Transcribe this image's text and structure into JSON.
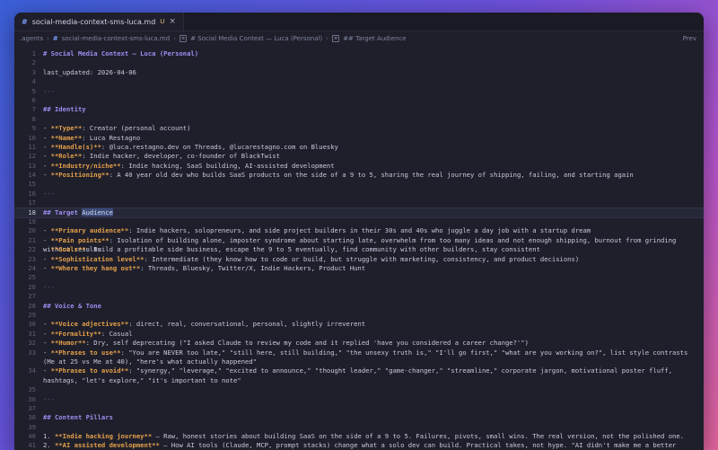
{
  "tab": {
    "icon": "#",
    "title": "social-media-context-sms-luca.md",
    "modified": "U"
  },
  "breadcrumb": {
    "folder": ".agents",
    "file": "social-media-context-sms-luca.md",
    "h1": "# Social Media Context — Luca (Personal)",
    "h2": "## Target Audience",
    "preview": "Prev"
  },
  "lines": [
    {
      "n": "1",
      "segs": [
        {
          "t": "# Social Media Context — Luca (Personal)",
          "c": "h"
        }
      ]
    },
    {
      "n": "2",
      "segs": []
    },
    {
      "n": "3",
      "segs": [
        {
          "t": "last_updated: 2026-04-06"
        }
      ]
    },
    {
      "n": "4",
      "segs": []
    },
    {
      "n": "5",
      "segs": [
        {
          "t": "---",
          "c": "d"
        }
      ]
    },
    {
      "n": "6",
      "segs": []
    },
    {
      "n": "7",
      "segs": [
        {
          "t": "## Identity",
          "c": "h"
        }
      ]
    },
    {
      "n": "8",
      "segs": []
    },
    {
      "n": "9",
      "segs": [
        {
          "t": "- "
        },
        {
          "t": "**Type**",
          "c": "b"
        },
        {
          "t": ": Creator (personal account)"
        }
      ]
    },
    {
      "n": "10",
      "segs": [
        {
          "t": "- "
        },
        {
          "t": "**Name**",
          "c": "b"
        },
        {
          "t": ": Luca Restagno"
        }
      ]
    },
    {
      "n": "11",
      "segs": [
        {
          "t": "- "
        },
        {
          "t": "**Handle(s)**",
          "c": "b"
        },
        {
          "t": ": @luca.restagno.dev on Threads, @lucarestagno.com on Bluesky"
        }
      ]
    },
    {
      "n": "12",
      "segs": [
        {
          "t": "- "
        },
        {
          "t": "**Role**",
          "c": "b"
        },
        {
          "t": ": Indie hacker, developer, co-founder of BlackTwist"
        }
      ]
    },
    {
      "n": "13",
      "segs": [
        {
          "t": "- "
        },
        {
          "t": "**Industry/niche**",
          "c": "b"
        },
        {
          "t": ": Indie hacking, SaaS building, AI-assisted development"
        }
      ]
    },
    {
      "n": "14",
      "segs": [
        {
          "t": "- "
        },
        {
          "t": "**Positioning**",
          "c": "b"
        },
        {
          "t": ": A 40 year old dev who builds SaaS products on the side of a 9 to 5, sharing the real journey of shipping, failing, and starting again"
        }
      ]
    },
    {
      "n": "15",
      "segs": []
    },
    {
      "n": "16",
      "segs": [
        {
          "t": "---",
          "c": "d"
        }
      ]
    },
    {
      "n": "17",
      "segs": []
    },
    {
      "n": "18",
      "active": true,
      "segs": [
        {
          "t": "## Target ",
          "c": "h"
        },
        {
          "t": "Audience",
          "c": "hl"
        }
      ]
    },
    {
      "n": "19",
      "segs": []
    },
    {
      "n": "20",
      "segs": [
        {
          "t": "- "
        },
        {
          "t": "**Primary audience**",
          "c": "b"
        },
        {
          "t": ": Indie hackers, solopreneurs, and side project builders in their 30s and 40s who juggle a day job with a startup dream"
        }
      ]
    },
    {
      "n": "21",
      "segs": [
        {
          "t": "- "
        },
        {
          "t": "**Pain points**",
          "c": "b"
        },
        {
          "t": ": Isolation of building alone, imposter syndrome about starting late, overwhelm from too many ideas and not enough shipping, burnout from grinding without results"
        }
      ]
    },
    {
      "n": "22",
      "segs": [
        {
          "t": "- "
        },
        {
          "t": "**Goals**",
          "c": "b"
        },
        {
          "t": ": Build a profitable side business, escape the 9 to 5 eventually, find community with other builders, stay consistent"
        }
      ]
    },
    {
      "n": "23",
      "segs": [
        {
          "t": "- "
        },
        {
          "t": "**Sophistication level**",
          "c": "b"
        },
        {
          "t": ": Intermediate (they know how to code or build, but struggle with marketing, consistency, and product decisions)"
        }
      ]
    },
    {
      "n": "24",
      "segs": [
        {
          "t": "- "
        },
        {
          "t": "**Where they hang out**",
          "c": "b"
        },
        {
          "t": ": Threads, Bluesky, Twitter/X, Indie Hackers, Product Hunt"
        }
      ]
    },
    {
      "n": "25",
      "segs": []
    },
    {
      "n": "26",
      "segs": [
        {
          "t": "---",
          "c": "d"
        }
      ]
    },
    {
      "n": "27",
      "segs": []
    },
    {
      "n": "28",
      "segs": [
        {
          "t": "## Voice & Tone",
          "c": "h"
        }
      ]
    },
    {
      "n": "29",
      "segs": []
    },
    {
      "n": "30",
      "segs": [
        {
          "t": "- "
        },
        {
          "t": "**Voice adjectives**",
          "c": "b"
        },
        {
          "t": ": direct, real, conversational, personal, slightly irreverent"
        }
      ]
    },
    {
      "n": "31",
      "segs": [
        {
          "t": "- "
        },
        {
          "t": "**Formality**",
          "c": "b"
        },
        {
          "t": ": Casual"
        }
      ]
    },
    {
      "n": "32",
      "segs": [
        {
          "t": "- "
        },
        {
          "t": "**Humor**",
          "c": "b"
        },
        {
          "t": ": Dry, self deprecating (\"I asked Claude to review my code and it replied 'have you considered a career change?'\")"
        }
      ]
    },
    {
      "n": "33",
      "wrap": true,
      "segs": [
        {
          "t": "- "
        },
        {
          "t": "**Phrases to use**",
          "c": "b"
        },
        {
          "t": ": \"You are NEVER too late,\" \"still here, still building,\" \"the unsexy truth is,\" \"I'll go first,\" \"what are you working on?\", list style contrasts (Me at 25 vs Me at 40), \"here's what actually happened\""
        }
      ]
    },
    {
      "n": "34",
      "wrap": true,
      "segs": [
        {
          "t": "- "
        },
        {
          "t": "**Phrases to avoid**",
          "c": "b"
        },
        {
          "t": ": \"synergy,\" \"leverage,\" \"excited to announce,\" \"thought leader,\" \"game-changer,\" \"streamline,\" corporate jargon, motivational poster fluff, hashtags, \"let's explore,\" \"it's important to note\""
        }
      ]
    },
    {
      "n": "35",
      "segs": []
    },
    {
      "n": "36",
      "segs": [
        {
          "t": "---",
          "c": "d"
        }
      ]
    },
    {
      "n": "37",
      "segs": []
    },
    {
      "n": "38",
      "segs": [
        {
          "t": "## Content Pillars",
          "c": "h"
        }
      ]
    },
    {
      "n": "39",
      "segs": []
    },
    {
      "n": "40",
      "segs": [
        {
          "t": "1. "
        },
        {
          "t": "**Indie hacking journey**",
          "c": "b"
        },
        {
          "t": " — Raw, honest stories about building SaaS on the side of a 9 to 5. Failures, pivots, small wins. The real version, not the polished one."
        }
      ]
    },
    {
      "n": "41",
      "segs": [
        {
          "t": "2. "
        },
        {
          "t": "**AI assisted development**",
          "c": "b"
        },
        {
          "t": " — How AI tools (Claude, MCP, prompt stacks) change what a solo dev can build. Practical takes, not hype. \"AI didn't make me a better coder. It made me"
        }
      ]
    }
  ]
}
